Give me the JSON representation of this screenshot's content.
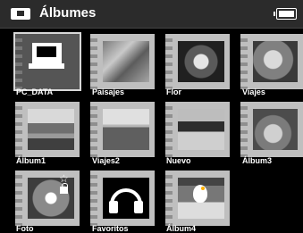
{
  "header": {
    "title": "Álbumes"
  },
  "albums": [
    {
      "label": "PC_DATA"
    },
    {
      "label": "Paisajes"
    },
    {
      "label": "Flor"
    },
    {
      "label": "Viajes"
    },
    {
      "label": "Álbum1"
    },
    {
      "label": "Viajes2"
    },
    {
      "label": "Nuevo"
    },
    {
      "label": "Álbum3"
    },
    {
      "label": "Foto"
    },
    {
      "label": "Favoritos"
    },
    {
      "label": "Álbum4"
    }
  ]
}
